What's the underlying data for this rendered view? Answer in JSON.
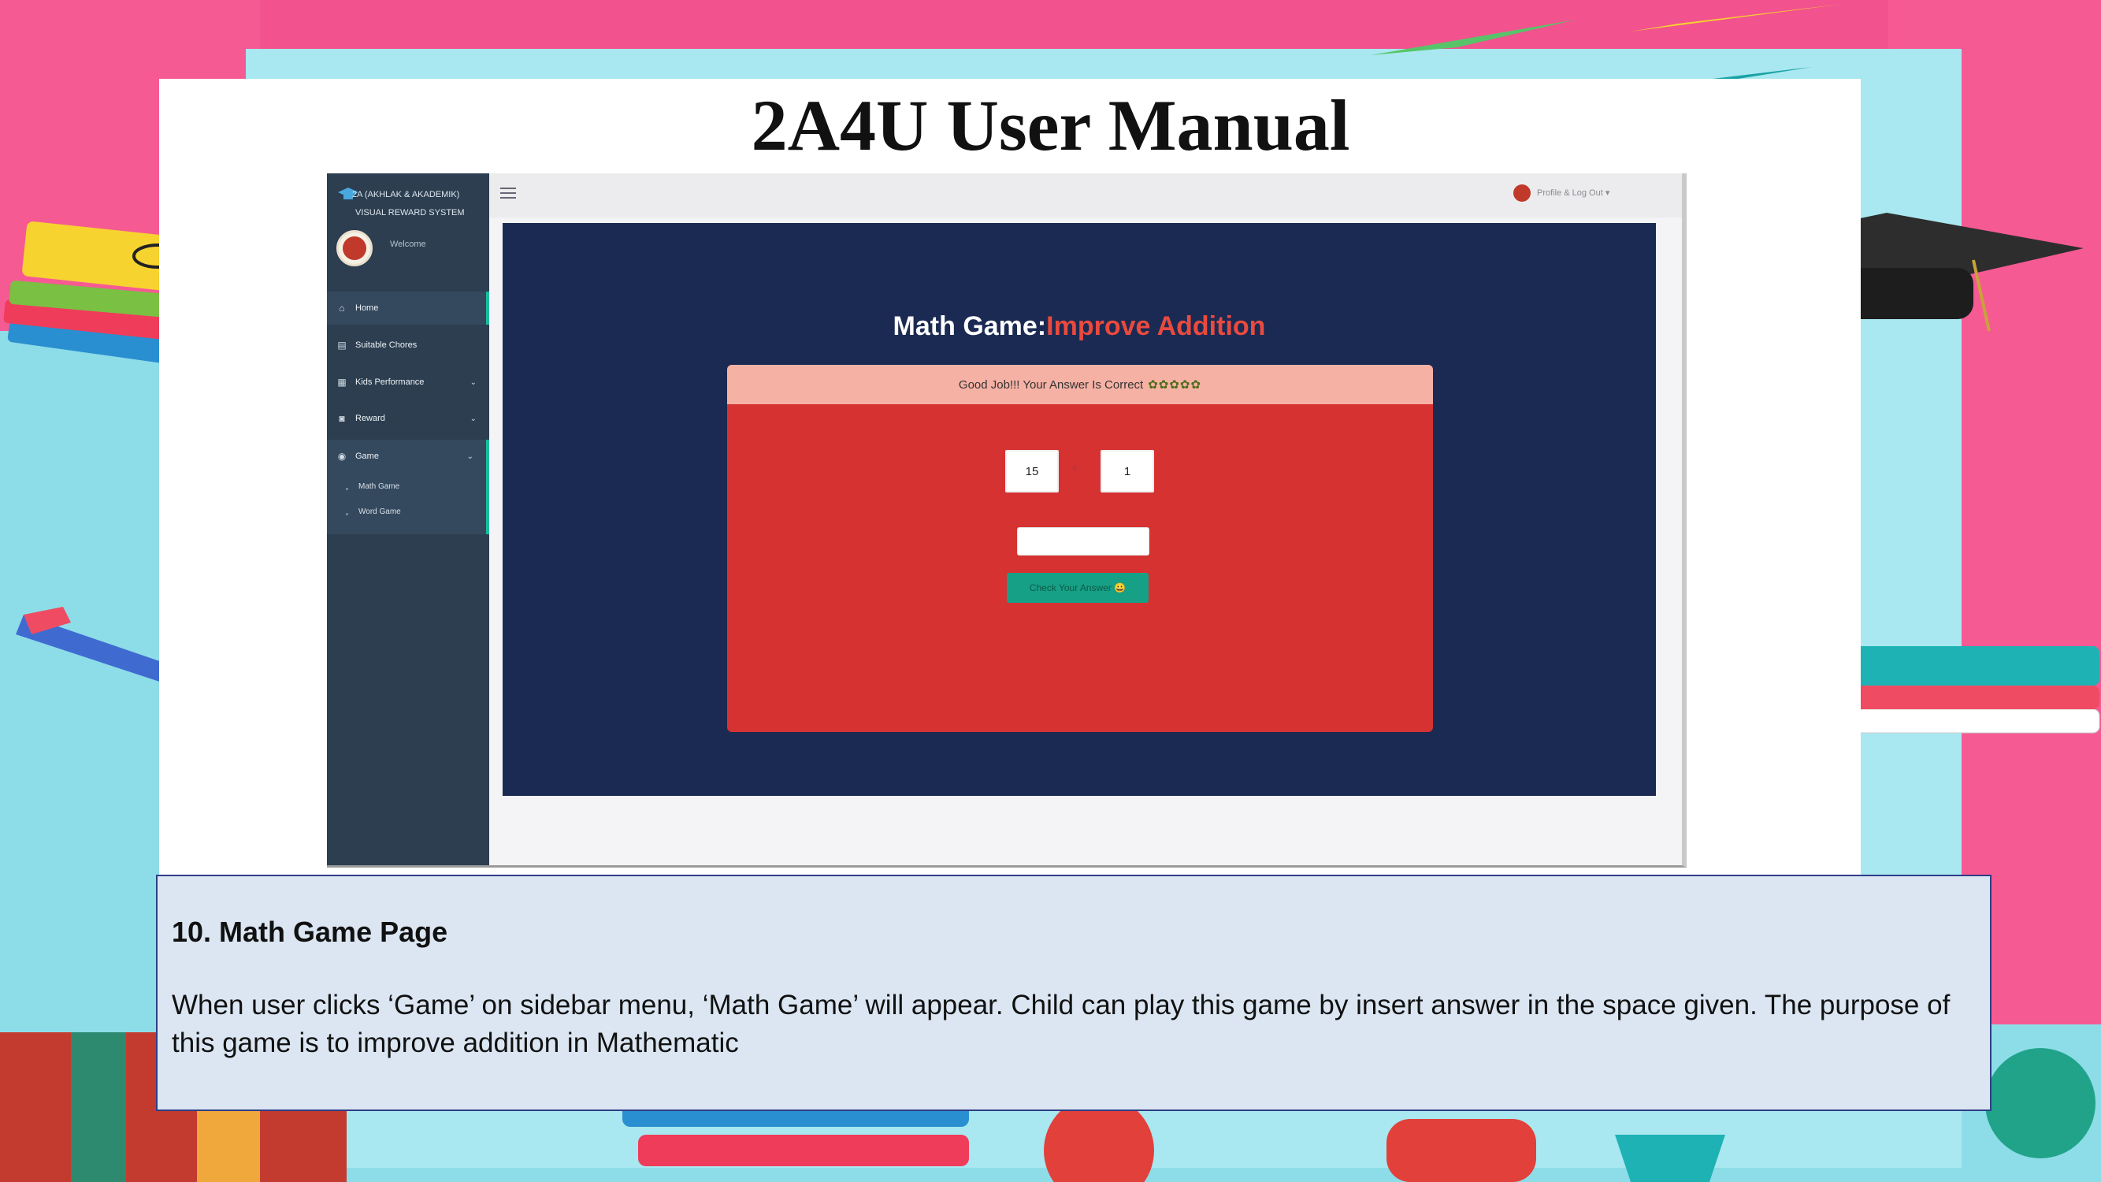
{
  "slide": {
    "title": "2A4U User Manual"
  },
  "app": {
    "brand_line1": "2A (AKHLAK & AKADEMIK)",
    "brand_line2": "VISUAL REWARD SYSTEM",
    "welcome": "Welcome",
    "profile_menu": "Profile & Log Out",
    "sidebar": {
      "items": [
        {
          "label": "Home",
          "icon": "home-icon"
        },
        {
          "label": "Suitable Chores",
          "icon": "file-icon"
        },
        {
          "label": "Kids Performance",
          "icon": "calendar-icon"
        },
        {
          "label": "Reward",
          "icon": "gift-icon"
        },
        {
          "label": "Game",
          "icon": "gamepad-icon"
        }
      ],
      "game_submenu": [
        "Math Game",
        "Word Game"
      ]
    },
    "game": {
      "title_prefix": "Math Game:",
      "title_suffix": "Improve Addition",
      "feedback": "Good Job!!! Your Answer Is Correct",
      "feedback_stars": "✿✿✿✿✿",
      "operand1": "15",
      "operator": "+",
      "operand2": "1",
      "answer_value": "",
      "check_button": "Check Your Answer 😀"
    },
    "colors": {
      "sidebar": "#2c3e50",
      "panel": "#1b2a52",
      "card": "#d63232",
      "accent": "#16a085",
      "title_highlight": "#e94a3f"
    }
  },
  "caption": {
    "heading": "10. Math Game Page",
    "body": "When user clicks ‘Game’ on sidebar menu, ‘Math Game’ will appear. Child can play this game by insert answer in the space given. The purpose of this game is to improve addition in Mathematic"
  }
}
